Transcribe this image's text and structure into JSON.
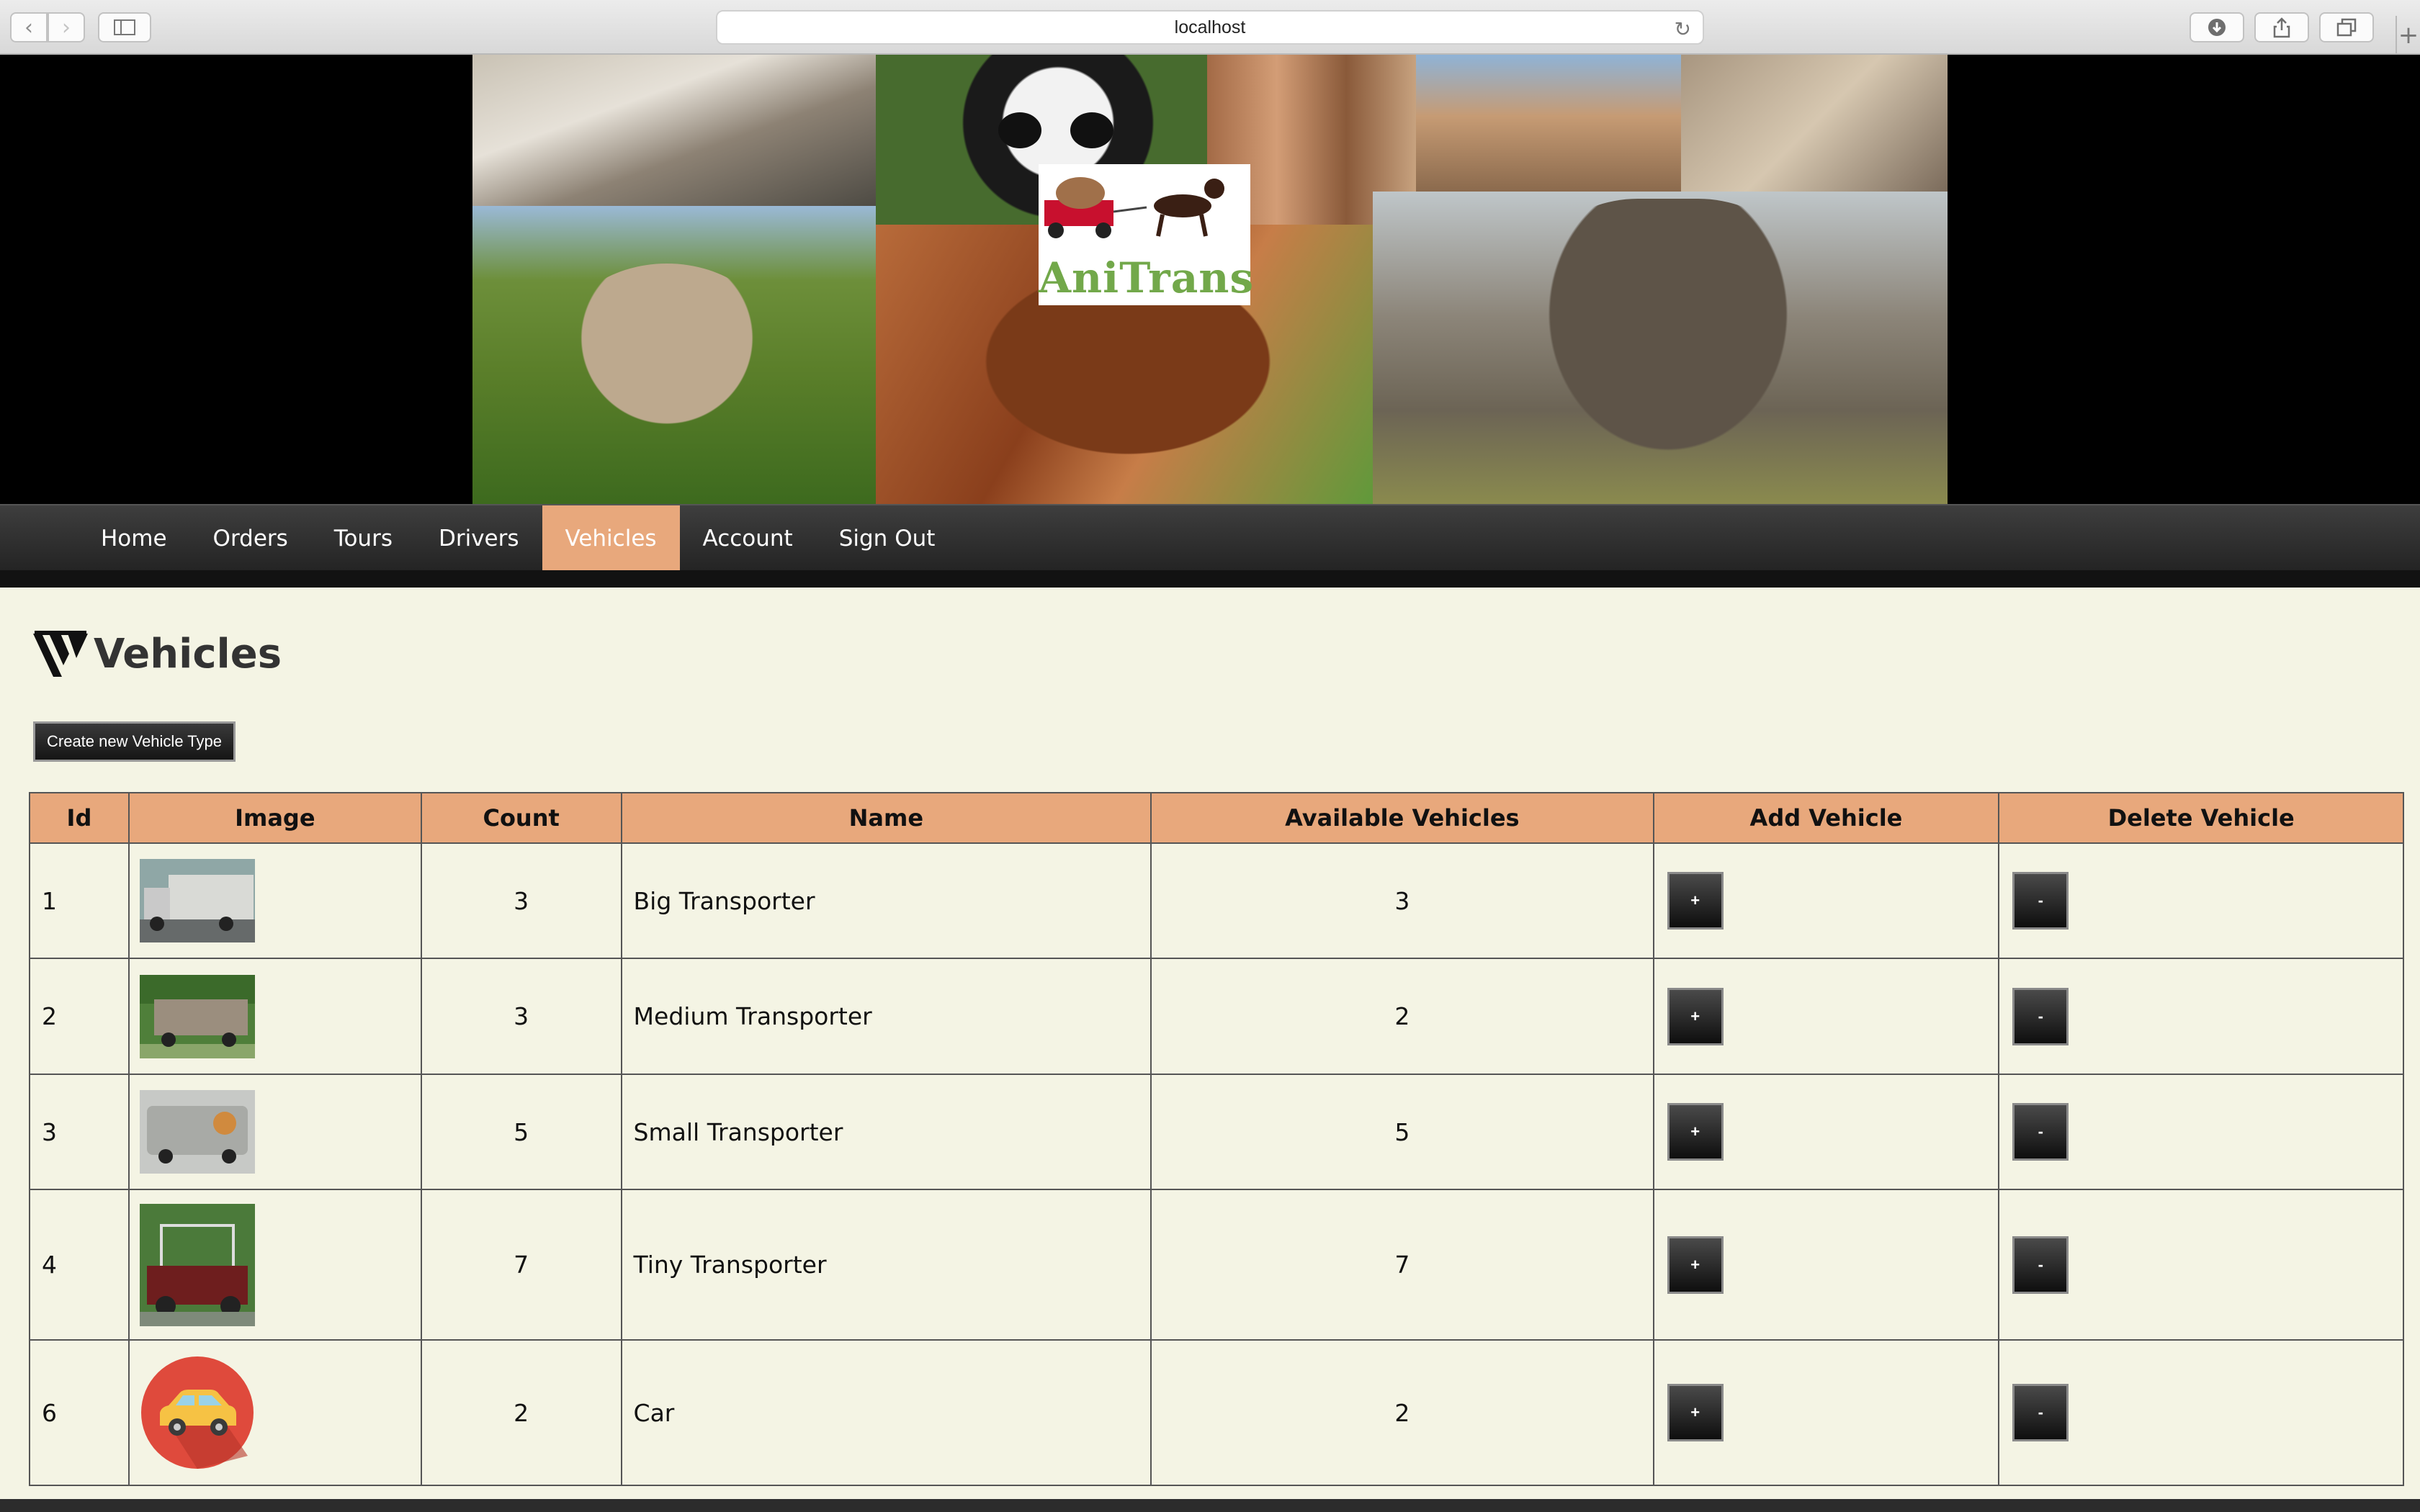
{
  "browser": {
    "url": "localhost"
  },
  "logo": {
    "text": "AniTrans"
  },
  "nav": {
    "items": [
      {
        "label": "Home",
        "active": false
      },
      {
        "label": "Orders",
        "active": false
      },
      {
        "label": "Tours",
        "active": false
      },
      {
        "label": "Drivers",
        "active": false
      },
      {
        "label": "Vehicles",
        "active": true
      },
      {
        "label": "Account",
        "active": false
      },
      {
        "label": "Sign Out",
        "active": false
      }
    ]
  },
  "page": {
    "title": "Vehicles",
    "create_button": "Create new Vehicle Type"
  },
  "table": {
    "headers": [
      "Id",
      "Image",
      "Count",
      "Name",
      "Available Vehicles",
      "Add Vehicle",
      "Delete Vehicle"
    ],
    "add_label": "+",
    "delete_label": "-",
    "rows": [
      {
        "id": "1",
        "image": "big-truck-photo",
        "count": "3",
        "name": "Big Transporter",
        "available": "3"
      },
      {
        "id": "2",
        "image": "medium-truck-photo",
        "count": "3",
        "name": "Medium Transporter",
        "available": "2"
      },
      {
        "id": "3",
        "image": "small-van-photo",
        "count": "5",
        "name": "Small Transporter",
        "available": "5"
      },
      {
        "id": "4",
        "image": "pickup-truck-photo",
        "count": "7",
        "name": "Tiny Transporter",
        "available": "7"
      },
      {
        "id": "6",
        "image": "car-icon",
        "count": "2",
        "name": "Car",
        "available": "2"
      }
    ]
  },
  "colors": {
    "header_bg": "#e8a87c",
    "active_nav": "#e8a87c",
    "page_bg": "#f4f4e4",
    "logo_green": "#72a84a"
  }
}
